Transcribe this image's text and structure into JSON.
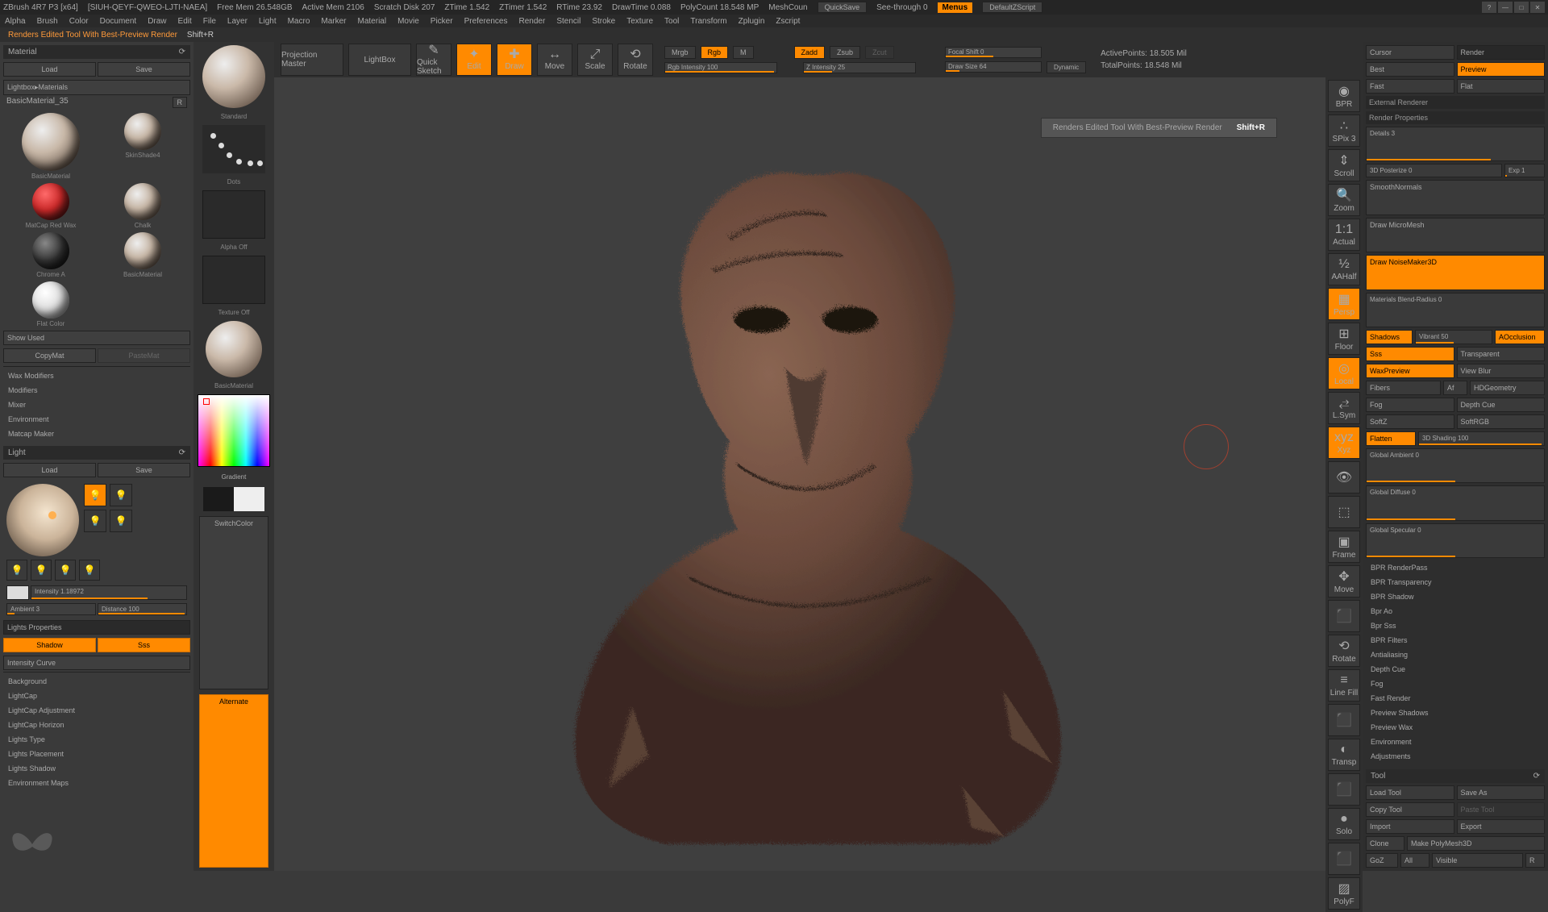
{
  "titlebar": {
    "app": "ZBrush 4R7 P3 [x64]",
    "doc": "[SIUH-QEYF-QWEO-LJTI-NAEA]",
    "freeMem": "Free Mem  26.548GB",
    "activeMem": "Active Mem  2106",
    "scratch": "Scratch Disk  207",
    "ztime": "ZTime  1.542",
    "ztimer": "ZTimer  1.542",
    "rtime": "RTime  23.92",
    "drawtime": "DrawTime  0.088",
    "polycount": "PolyCount  18.548 MP",
    "meshcount": "MeshCoun",
    "quicksave": "QuickSave",
    "seethrough": "See-through  0",
    "menus": "Menus",
    "zscript": "DefaultZScript"
  },
  "menus": [
    "Alpha",
    "Brush",
    "Color",
    "Document",
    "Draw",
    "Edit",
    "File",
    "Layer",
    "Light",
    "Macro",
    "Marker",
    "Material",
    "Movie",
    "Picker",
    "Preferences",
    "Render",
    "Stencil",
    "Stroke",
    "Texture",
    "Tool",
    "Transform",
    "Zplugin",
    "Zscript"
  ],
  "hint": {
    "text": "Renders Edited Tool With Best-Preview Render",
    "shortcut": "Shift+R"
  },
  "topTools": {
    "projection": "Projection\nMaster",
    "lightbox": "LightBox",
    "quickSketch": "Quick\nSketch",
    "edit": "Edit",
    "draw": "Draw",
    "move": "Move",
    "scale": "Scale",
    "rotate": "Rotate",
    "mrgb": "Mrgb",
    "rgb": "Rgb",
    "m": "M",
    "rgbInt": "Rgb Intensity 100",
    "zadd": "Zadd",
    "zsub": "Zsub",
    "zcut": "Zcut",
    "zInt": "Z Intensity 25",
    "focal": "Focal Shift 0",
    "drawSize": "Draw Size 64",
    "dynamic": "Dynamic",
    "active": "ActivePoints: 18.505 Mil",
    "total": "TotalPoints: 18.548 Mil"
  },
  "material": {
    "title": "Material",
    "load": "Load",
    "save": "Save",
    "lightbox": "Lightbox▸Materials",
    "current": "BasicMaterial_35",
    "r": "R",
    "swatches": [
      {
        "name": "BasicMaterial",
        "cls": "big"
      },
      {
        "name": "SkinShade4",
        "cls": ""
      },
      {
        "name": "MatCap Red Wax",
        "cls": "red"
      },
      {
        "name": "Chalk",
        "cls": ""
      },
      {
        "name": "Chrome A",
        "cls": "dark"
      },
      {
        "name": "BasicMaterial",
        "cls": ""
      },
      {
        "name": "Flat Color",
        "cls": "white"
      }
    ],
    "showUsed": "Show Used",
    "copy": "CopyMat",
    "paste": "PasteMat",
    "sections": [
      "Wax Modifiers",
      "Modifiers",
      "Mixer",
      "Environment",
      "Matcap Maker"
    ]
  },
  "light": {
    "title": "Light",
    "load": "Load",
    "save": "Save",
    "intensity": "Intensity 1.18972",
    "ambient": "Ambient 3",
    "distance": "Distance 100",
    "propsTitle": "Lights Properties",
    "shadow": "Shadow",
    "sss": "Sss",
    "intCurve": "Intensity Curve",
    "sections": [
      "Background",
      "LightCap",
      "LightCap Adjustment",
      "LightCap Horizon",
      "Lights Type",
      "Lights Placement",
      "Lights Shadow",
      "Environment Maps"
    ]
  },
  "strip": {
    "standard": "Standard",
    "dots": "Dots",
    "alphaOff": "Alpha Off",
    "texOff": "Texture Off",
    "basicMat": "BasicMaterial",
    "gradient": "Gradient",
    "switch": "SwitchColor",
    "alternate": "Alternate"
  },
  "rightTools": [
    "BPR",
    "SPix 3",
    "Scroll",
    "Zoom",
    "Actual",
    "AAHalf",
    "Persp",
    "Floor",
    "Local",
    "L.Sym",
    "Xyz",
    "",
    "",
    "Frame",
    "Move",
    "",
    "Rotate",
    "Line Fill",
    "",
    "Transp",
    "",
    "Solo",
    "",
    "PolyF"
  ],
  "render": {
    "cursor": "Cursor",
    "renderTitle": "Render",
    "best": "Best",
    "preview": "Preview",
    "fast": "Fast",
    "flat": "Flat",
    "ext": "External Renderer",
    "props": "Render Properties",
    "details": "Details 3",
    "post": "3D Posterize 0",
    "exp": "Exp 1",
    "smooth": "SmoothNormals",
    "micro": "Draw MicroMesh",
    "noise": "Draw NoiseMaker3D",
    "blend": "Materials Blend-Radius 0",
    "shadows": "Shadows",
    "vibrant": "Vibrant 50",
    "aocc": "AOcclusion",
    "sss": "Sss",
    "transp": "Transparent",
    "wax": "WaxPreview",
    "vblur": "View Blur",
    "fibers": "Fibers",
    "af": "Af",
    "hd": "HDGeometry",
    "fog": "Fog",
    "depth": "Depth Cue",
    "softz": "SoftZ",
    "softrgb": "SoftRGB",
    "flatten": "Flatten",
    "shading": "3D Shading 100",
    "gamb": "Global Ambient 0",
    "gdiff": "Global Diffuse 0",
    "gspec": "Global Specular 0",
    "sections": [
      "BPR RenderPass",
      "BPR Transparency",
      "BPR Shadow",
      "Bpr Ao",
      "Bpr Sss",
      "BPR Filters",
      "Antialiasing",
      "Depth Cue",
      "Fog",
      "Fast Render",
      "Preview Shadows",
      "Preview Wax",
      "Environment",
      "Adjustments"
    ]
  },
  "tool": {
    "title": "Tool",
    "load": "Load Tool",
    "save": "Save As",
    "copy": "Copy Tool",
    "paste": "Paste Tool",
    "import": "Import",
    "export": "Export",
    "clone": "Clone",
    "make": "Make PolyMesh3D",
    "goz": "GoZ",
    "all": "All",
    "visible": "Visible",
    "r": "R"
  }
}
